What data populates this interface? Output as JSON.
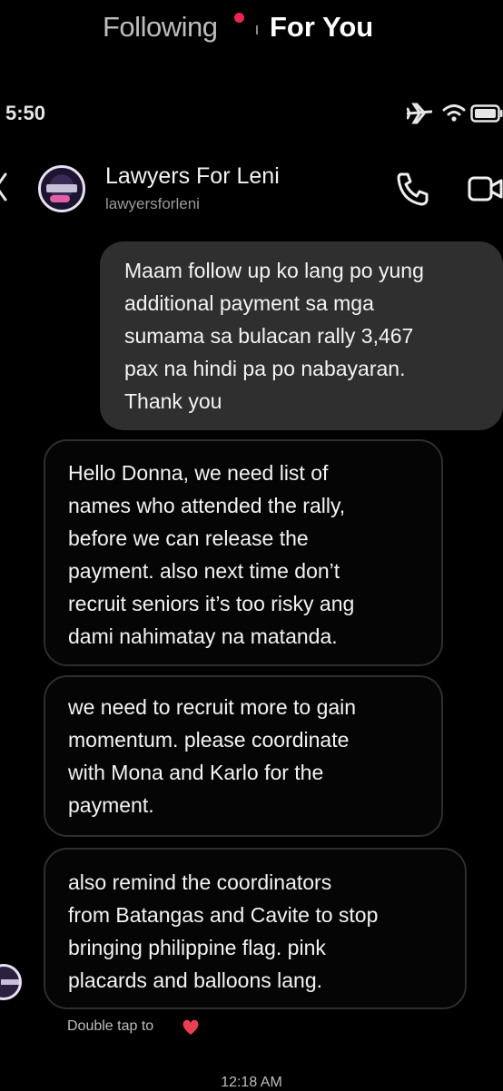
{
  "top_tabs": {
    "following": "Following",
    "for_you": "For You"
  },
  "status_bar": {
    "time": "5:50",
    "icons": [
      "airplane-icon",
      "wifi-icon",
      "battery-icon"
    ]
  },
  "header": {
    "contact_name": "Lawyers For Leni",
    "contact_handle": "lawyersforleni",
    "icons": [
      "back-icon",
      "avatar",
      "call-icon",
      "video-icon"
    ]
  },
  "messages": [
    {
      "direction": "outgoing",
      "text": "Maam follow up ko lang po yung\nadditional payment sa mga\nsumama sa bulacan rally 3,467\npax na hindi pa po nabayaran.\nThank you"
    },
    {
      "direction": "incoming",
      "text": "Hello Donna, we need list of\nnames who attended the rally,\nbefore we can release the\npayment. also next time don’t\nrecruit seniors it’s too risky ang\ndami nahimatay na matanda."
    },
    {
      "direction": "incoming",
      "text": "we need to recruit more to gain\nmomentum. please coordinate\nwith Mona and Karlo for the\npayment."
    },
    {
      "direction": "incoming",
      "text": "also remind the coordinators\nfrom Batangas and Cavite to stop\nbringing philippine flag. pink\nplacards and balloons lang."
    }
  ],
  "reaction_hint": {
    "text": "Double tap to",
    "icon": "heart-icon"
  },
  "timestamp": "12:18 AM",
  "colors": {
    "background": "#000000",
    "outgoing_bubble": "#2f2f2f",
    "incoming_border": "#2e2e2e",
    "notification_dot": "#f0254f",
    "heart": "#e8404f"
  }
}
